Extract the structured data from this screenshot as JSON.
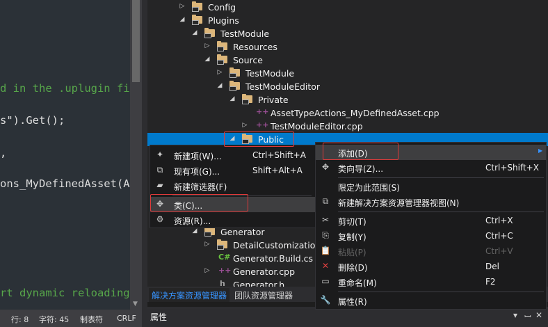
{
  "editor": {
    "lines": [
      {
        "text": "d in the .uplugin fi",
        "kind": "comment"
      },
      {
        "text": "s\").Get();",
        "kind": "code"
      },
      {
        "text": ",",
        "kind": "code"
      },
      {
        "text": "ons_MyDefinedAsset(A",
        "kind": "code"
      },
      {
        "text": "rt dynamic reloading",
        "kind": "comment"
      }
    ]
  },
  "statusbar": {
    "line": "行: 8",
    "char": "字符: 45",
    "tabs": "制表符",
    "eol": "CRLF"
  },
  "explorer": {
    "tree": [
      {
        "label": "Config",
        "type": "folder",
        "expander": "▷"
      },
      {
        "label": "Plugins",
        "type": "folder",
        "expander": "◢"
      },
      {
        "label": "TestModule",
        "type": "folder",
        "expander": "◢"
      },
      {
        "label": "Resources",
        "type": "folder",
        "expander": "▷"
      },
      {
        "label": "Source",
        "type": "folder",
        "expander": "◢"
      },
      {
        "label": "TestModule",
        "type": "folder",
        "expander": "▷"
      },
      {
        "label": "TestModuleEditor",
        "type": "folder",
        "expander": "◢"
      },
      {
        "label": "Private",
        "type": "folder",
        "expander": "◢"
      },
      {
        "label": "AssetTypeActions_MyDefinedAsset.cpp",
        "type": "cpp",
        "expander": ""
      },
      {
        "label": "TestModuleEditor.cpp",
        "type": "cpp",
        "expander": "▷"
      },
      {
        "label": "Public",
        "type": "folder",
        "expander": "◢"
      },
      {
        "label": "Generator",
        "type": "folder",
        "expander": "◢"
      },
      {
        "label": "DetailCustomization",
        "type": "folder",
        "expander": "▷"
      },
      {
        "label": "Generator.Build.cs",
        "type": "cs",
        "expander": ""
      },
      {
        "label": "Generator.cpp",
        "type": "cpp",
        "expander": "▷"
      },
      {
        "label": "Generator.h",
        "type": "h",
        "expander": ""
      }
    ],
    "tabs": [
      "解决方案资源管理器",
      "团队资源管理器"
    ],
    "properties_title": "属性",
    "properties_buttons": [
      "▾",
      "ꟷ",
      "✕"
    ]
  },
  "submenu": {
    "items": [
      {
        "icon": "new-item-icon",
        "glyph": "✦",
        "label": "新建项(W)...",
        "shortcut": "Ctrl+Shift+A"
      },
      {
        "icon": "existing-item-icon",
        "glyph": "⧉",
        "label": "现有项(G)...",
        "shortcut": "Shift+Alt+A"
      },
      {
        "icon": "new-filter-icon",
        "glyph": "▰",
        "label": "新建筛选器(F)",
        "shortcut": ""
      },
      {
        "icon": "class-icon",
        "glyph": "✥",
        "label": "类(C)...",
        "shortcut": ""
      },
      {
        "icon": "resource-icon",
        "glyph": "⚙",
        "label": "资源(R)...",
        "shortcut": ""
      }
    ]
  },
  "context_menu": {
    "items": [
      {
        "icon": "",
        "glyph": "",
        "label": "添加(D)",
        "shortcut": "",
        "submenu": true
      },
      {
        "icon": "class-wizard-icon",
        "glyph": "✥",
        "label": "类向导(Z)...",
        "shortcut": "Ctrl+Shift+X"
      },
      {
        "icon": "",
        "glyph": "",
        "label": "限定为此范围(S)",
        "shortcut": ""
      },
      {
        "icon": "new-view-icon",
        "glyph": "⧉",
        "label": "新建解决方案资源管理器视图(N)",
        "shortcut": ""
      },
      {
        "icon": "cut-icon",
        "glyph": "✂",
        "label": "剪切(T)",
        "shortcut": "Ctrl+X"
      },
      {
        "icon": "copy-icon",
        "glyph": "⎘",
        "label": "复制(Y)",
        "shortcut": "Ctrl+C"
      },
      {
        "icon": "paste-icon",
        "glyph": "📋",
        "label": "粘贴(P)",
        "shortcut": "Ctrl+V",
        "disabled": true
      },
      {
        "icon": "delete-icon",
        "glyph": "✕",
        "label": "删除(D)",
        "shortcut": "Del"
      },
      {
        "icon": "rename-icon",
        "glyph": "▭",
        "label": "重命名(M)",
        "shortcut": "F2"
      },
      {
        "icon": "properties-icon",
        "glyph": "🔧",
        "label": "属性(R)",
        "shortcut": ""
      }
    ]
  },
  "colors": {
    "selection": "#007acc",
    "highlight_box": "#e03a3a",
    "delete_icon": "#e04040"
  }
}
